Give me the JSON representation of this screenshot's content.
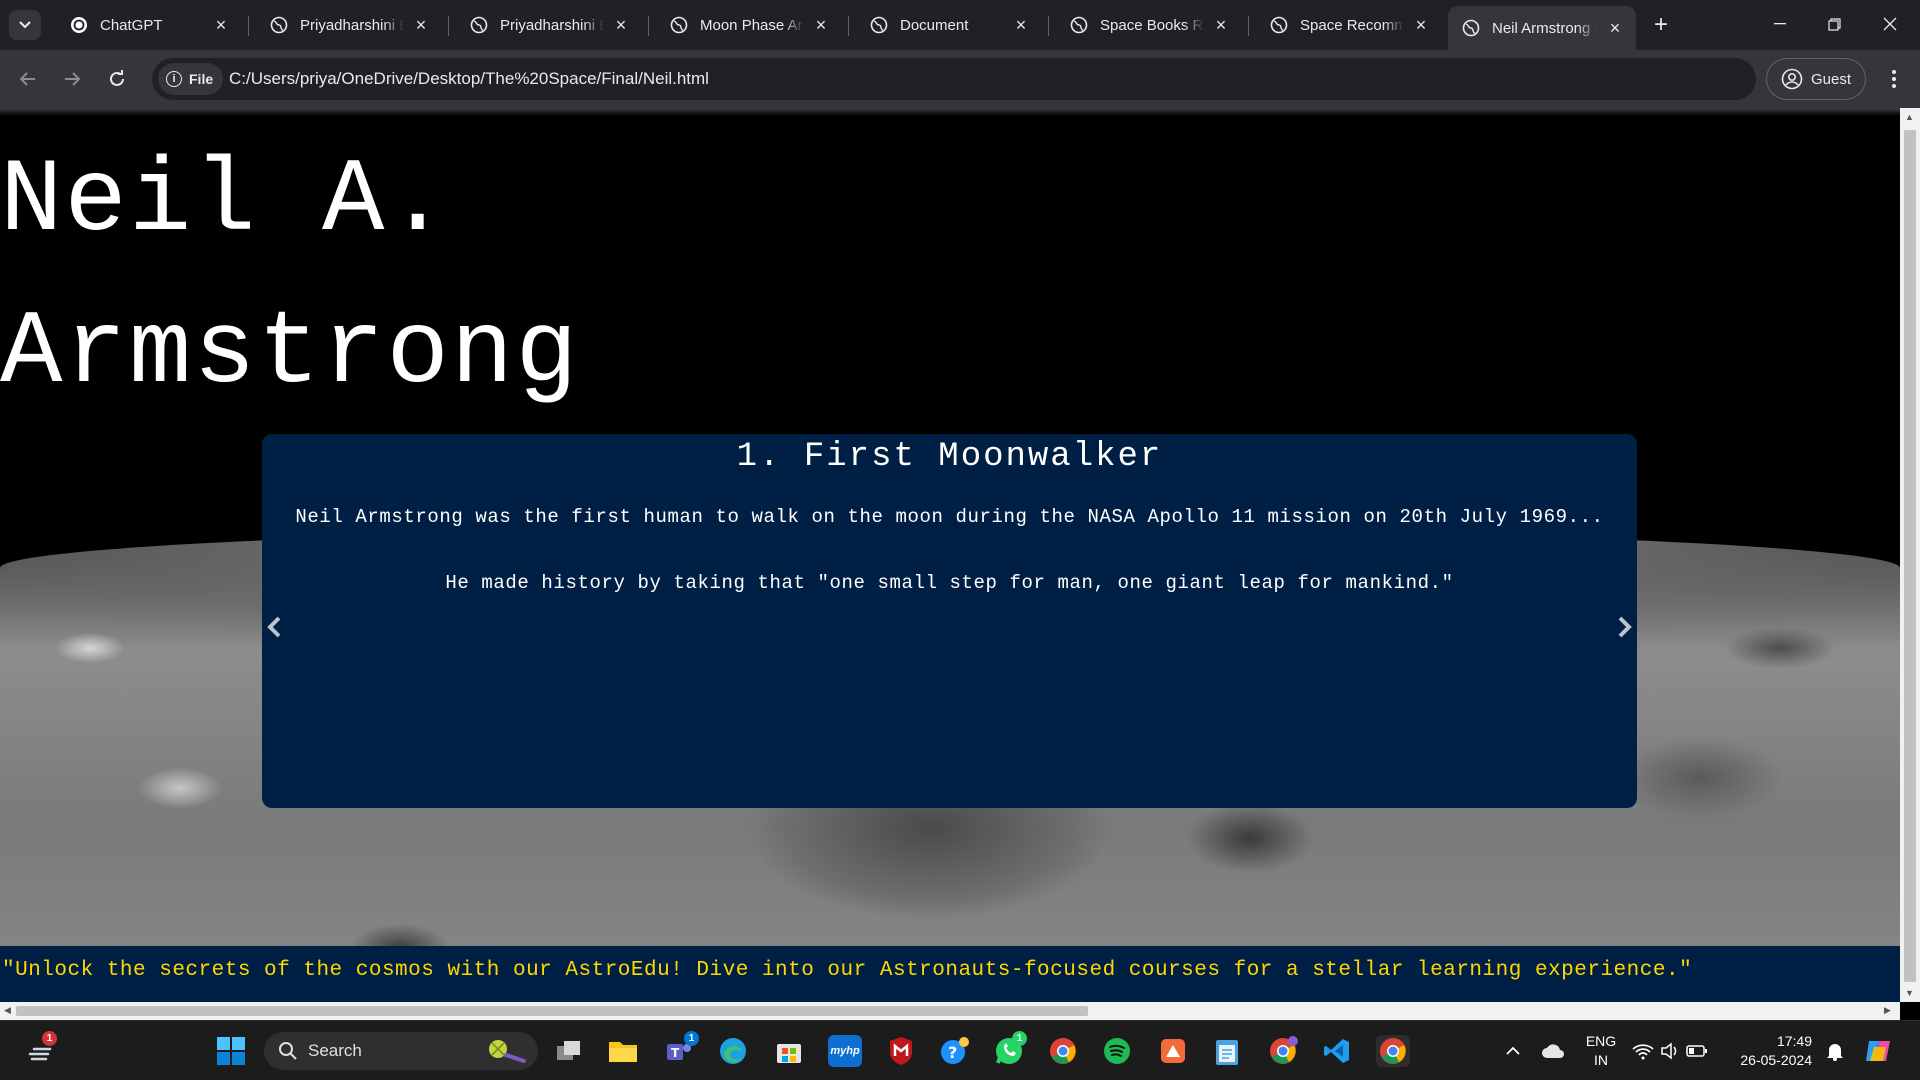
{
  "browser": {
    "tabs": [
      {
        "label": "ChatGPT",
        "icon": "chatgpt-icon"
      },
      {
        "label": "Priyadharshini B",
        "icon": "globe-icon"
      },
      {
        "label": "Priyadharshini B",
        "icon": "globe-icon"
      },
      {
        "label": "Moon Phase Art",
        "icon": "globe-icon"
      },
      {
        "label": "Document",
        "icon": "globe-icon"
      },
      {
        "label": "Space Books Rec",
        "icon": "globe-icon"
      },
      {
        "label": "Space Recomme",
        "icon": "globe-icon"
      },
      {
        "label": "Neil Armstrong -",
        "icon": "globe-icon",
        "active": true
      }
    ],
    "address": {
      "scheme_chip": "File",
      "url": "C:/Users/priya/OneDrive/Desktop/The%20Space/Final/Neil.html"
    },
    "profile_label": "Guest"
  },
  "page": {
    "title_line1": "Neil A.",
    "title_line2": "Armstrong",
    "slide": {
      "heading": "1. First Moonwalker",
      "paragraph1": "Neil Armstrong was the first human to walk on the moon during the NASA Apollo 11 mission on 20th July 1969...",
      "paragraph2": "He made history by taking that \"one small step for man, one giant leap for mankind.\""
    },
    "footer_text": "\"Unlock the secrets of the cosmos with our AstroEdu! Dive into our Astronauts-focused courses for a stellar learning experience.\"",
    "colors": {
      "slide_bg": "#001f44",
      "footer_text": "#ffd700",
      "title": "#ffffff"
    }
  },
  "taskbar": {
    "search_label": "Search",
    "notification_count": "1",
    "teams_badge": "1",
    "whatsapp_badge": "1",
    "language_line1": "ENG",
    "language_line2": "IN",
    "time": "17:49",
    "date": "26-05-2024"
  }
}
